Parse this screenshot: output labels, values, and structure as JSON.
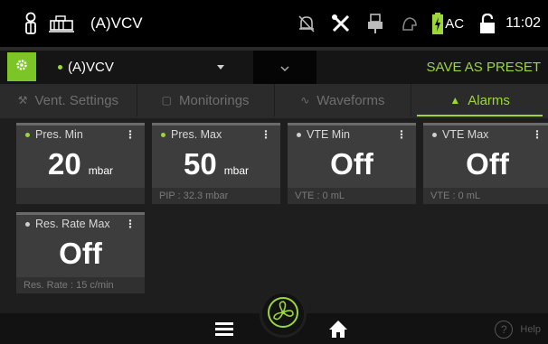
{
  "status_bar": {
    "mode": "(A)VCV",
    "power_label": "AC",
    "time": "11:02",
    "icons": [
      "patient-icon",
      "ventilator-icon",
      "alarm-silenced-icon",
      "tools-icon",
      "connection-icon",
      "profile-icon",
      "battery-charging-icon",
      "unlocked-icon"
    ]
  },
  "mode_bar": {
    "selected_mode": "(A)VCV",
    "save_preset_label": "SAVE AS PRESET",
    "settings_icon": "gear-icon"
  },
  "tabs": [
    {
      "label": "Vent. Settings",
      "icon": "wrench-icon",
      "active": false
    },
    {
      "label": "Monitorings",
      "icon": "monitor-icon",
      "active": false
    },
    {
      "label": "Waveforms",
      "icon": "wave-icon",
      "active": false
    },
    {
      "label": "Alarms",
      "icon": "bell-icon",
      "active": true
    }
  ],
  "alarm_tiles": [
    {
      "title": "Pres. Min",
      "value": "20",
      "unit": "mbar",
      "footer": "",
      "dot_color": "#9bd63a"
    },
    {
      "title": "Pres. Max",
      "value": "50",
      "unit": "mbar",
      "footer": "PIP : 32.3 mbar",
      "dot_color": "#9bd63a"
    },
    {
      "title": "VTE Min",
      "value": "Off",
      "unit": "",
      "footer": "VTE : 0 mL",
      "dot_color": "#cfcfcf"
    },
    {
      "title": "VTE Max",
      "value": "Off",
      "unit": "",
      "footer": "VTE : 0 mL",
      "dot_color": "#cfcfcf"
    },
    {
      "title": "Res. Rate Max",
      "value": "Off",
      "unit": "",
      "footer": "Res. Rate : 15 c/min",
      "dot_color": "#cfcfcf"
    }
  ],
  "bottom_bar": {
    "help_label": "Help",
    "buttons": [
      "menu-icon",
      "fan-icon",
      "home-icon"
    ]
  },
  "colors": {
    "accent": "#9bd63a",
    "tile_bg": "#3d3d3d",
    "background": "#1e1e1e"
  }
}
